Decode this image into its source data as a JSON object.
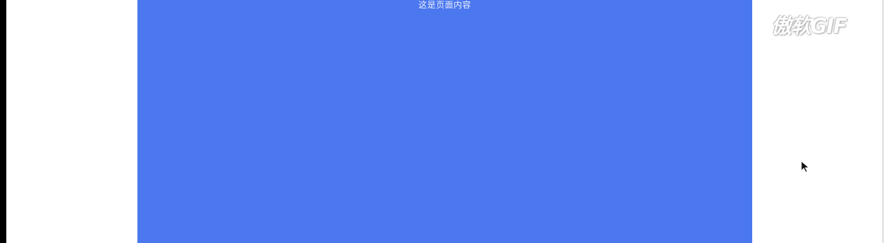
{
  "page": {
    "content_text": "这是页面内容",
    "content_color": "#4c78ef",
    "background_color": "#ffffff"
  },
  "watermark": {
    "text": "傲软GIF"
  },
  "icons": {
    "cursor": "mouse-pointer-icon"
  }
}
